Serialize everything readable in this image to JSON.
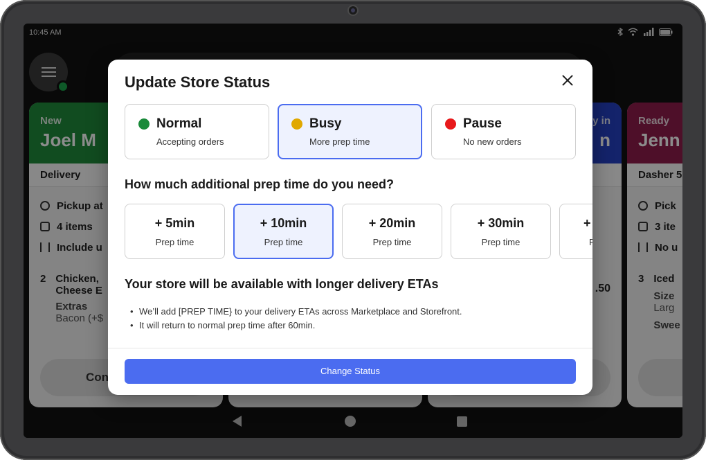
{
  "device": {
    "time": "10:45 AM"
  },
  "background": {
    "cards": [
      {
        "status": "New",
        "name": "Joel M",
        "fulfillment": "Delivery",
        "rows": [
          "Pickup at",
          "4 items",
          "Include u"
        ],
        "item_qty": "2",
        "item_name": "Chicken,",
        "item_name2": "Cheese E",
        "extras_label": "Extras",
        "extras_value": "Bacon (+$",
        "button": "Con",
        "color": "#1f8a3b"
      },
      {
        "status": "y in",
        "name": "n",
        "price": ".50",
        "color": "#2541c4"
      },
      {
        "status": "Ready",
        "name": "Jenn",
        "fulfillment": "Dasher 5",
        "rows": [
          "Pick",
          "3 ite",
          "No u"
        ],
        "item_qty": "3",
        "item_name": "Iced",
        "size_label": "Size",
        "size_value": "Larg",
        "sweet_label": "Swee",
        "color": "#8e1c4b"
      }
    ]
  },
  "modal": {
    "title": "Update Store Status",
    "status_options": [
      {
        "label": "Normal",
        "description": "Accepting orders",
        "dot_color": "#1a8a3a",
        "selected": false
      },
      {
        "label": "Busy",
        "description": "More prep time",
        "dot_color": "#e0a800",
        "selected": true
      },
      {
        "label": "Pause",
        "description": "No new orders",
        "dot_color": "#e8191b",
        "selected": false
      }
    ],
    "question": "How much additional prep time do you need?",
    "prep_options": [
      {
        "value": "+ 5min",
        "label": "Prep time",
        "selected": false
      },
      {
        "value": "+ 10min",
        "label": "Prep time",
        "selected": true
      },
      {
        "value": "+ 20min",
        "label": "Prep time",
        "selected": false
      },
      {
        "value": "+ 30min",
        "label": "Prep time",
        "selected": false
      },
      {
        "value": "+",
        "label": "P",
        "selected": false
      }
    ],
    "info_title": "Your store will be available with longer delivery ETAs",
    "bullets": [
      "We’ll add [PREP TIME} to your delivery ETAs across Marketplace and Storefront.",
      "It will return to normal prep time after 60min."
    ],
    "cta": "Change Status",
    "accent_color": "#4b6cf0"
  }
}
